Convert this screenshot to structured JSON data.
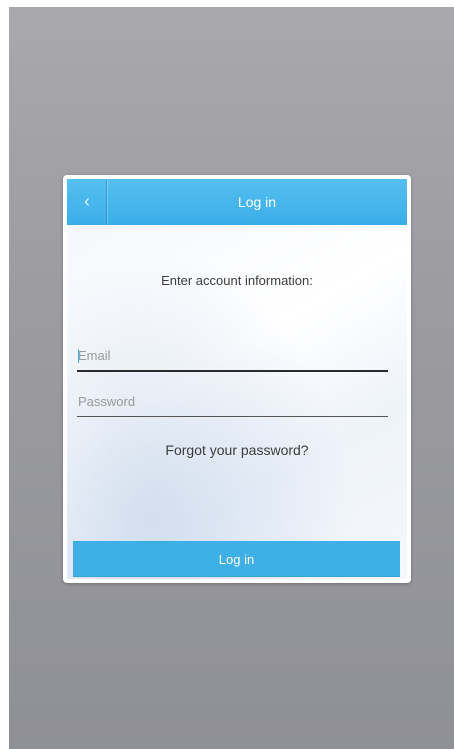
{
  "dialog": {
    "title": "Log in",
    "back_icon": "chevron-left-icon",
    "instruction": "Enter account information:",
    "email": {
      "placeholder": "Email",
      "value": ""
    },
    "password": {
      "placeholder": "Password",
      "value": ""
    },
    "forgot_link": "Forgot your password?",
    "submit_label": "Log in"
  },
  "colors": {
    "accent": "#3aaee8",
    "backdrop": "#9c9ca0"
  }
}
